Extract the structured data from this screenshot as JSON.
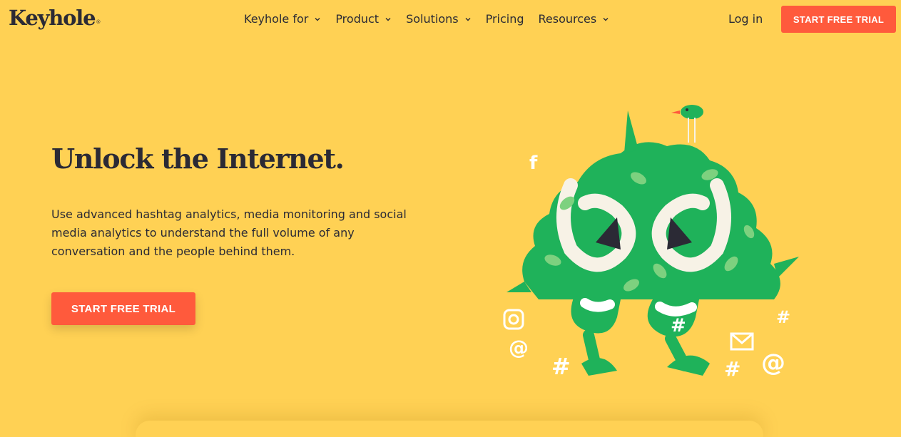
{
  "brand": {
    "logo_text": "Keyhole",
    "reg_mark": "®"
  },
  "nav": {
    "items": [
      {
        "label": "Keyhole for",
        "has_dropdown": true
      },
      {
        "label": "Product",
        "has_dropdown": true
      },
      {
        "label": "Solutions",
        "has_dropdown": true
      },
      {
        "label": "Pricing",
        "has_dropdown": false
      },
      {
        "label": "Resources",
        "has_dropdown": true
      }
    ],
    "login_label": "Log in",
    "cta_label": "START FREE TRIAL"
  },
  "hero": {
    "headline": "Unlock the Internet.",
    "subtext": "Use advanced hashtag analytics, media monitoring and social media analytics to understand the full volume of any conversation and the people behind them.",
    "cta_label": "START FREE TRIAL",
    "illustration_icons": [
      "facebook-icon",
      "instagram-icon",
      "at-sign-icon",
      "hashtag-icon",
      "mail-icon",
      "bird-icon",
      "bush-creature"
    ]
  },
  "colors": {
    "background": "#FFD154",
    "accent": "#FF5A3C",
    "text": "#2B2A35",
    "leaf_green": "#1FB25A",
    "leaf_light": "#7DD17F"
  }
}
